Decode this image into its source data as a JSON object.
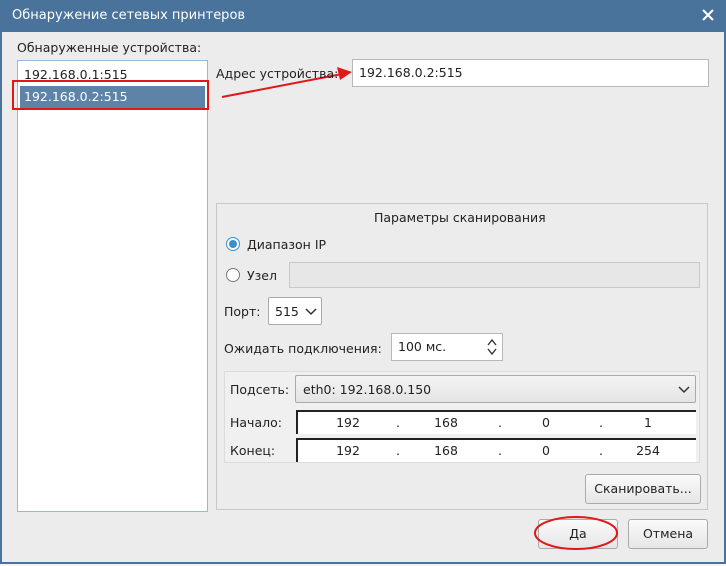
{
  "window": {
    "title": "Обнаружение сетевых принтеров"
  },
  "devices": {
    "label": "Обнаруженные устройства:",
    "items": [
      {
        "label": "192.168.0.1:515"
      },
      {
        "label": "192.168.0.2:515"
      }
    ]
  },
  "address": {
    "label": "Адрес устройства:",
    "value": "192.168.0.2:515"
  },
  "scan": {
    "title": "Параметры сканирования",
    "range_label": "Диапазон IP",
    "host_label": "Узел",
    "host_value": "",
    "port_label": "Порт:",
    "port_value": "515",
    "wait_label": "Ожидать подключения:",
    "wait_value": "100 мс.",
    "subnet_label": "Подсеть:",
    "subnet_value": "eth0: 192.168.0.150",
    "start_label": "Начало:",
    "start_ip": [
      "192",
      "168",
      "0",
      "1"
    ],
    "end_label": "Конец:",
    "end_ip": [
      "192",
      "168",
      "0",
      "254"
    ],
    "dot": ".",
    "scan_button": "Сканировать..."
  },
  "buttons": {
    "ok": "Да",
    "cancel": "Отмена"
  },
  "colors": {
    "titlebar": "#4a739c",
    "selection": "#5d83a8",
    "annotation": "#e01818"
  }
}
